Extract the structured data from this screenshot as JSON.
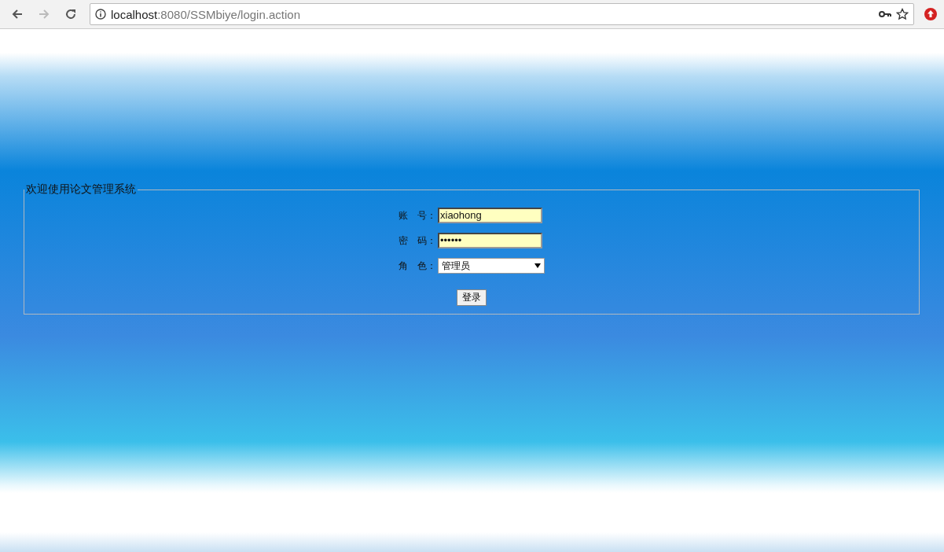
{
  "browser": {
    "url_host": "localhost",
    "url_path": ":8080/SSMbiye/login.action"
  },
  "login": {
    "legend": "欢迎使用论文管理系统",
    "fields": [
      {
        "kind": "text",
        "label": "账　号：",
        "value": "xiaohong"
      },
      {
        "kind": "password",
        "label": "密　码：",
        "value": "••••••"
      },
      {
        "kind": "select",
        "label": "角　色：",
        "value": "管理员"
      }
    ],
    "button": "登录"
  }
}
